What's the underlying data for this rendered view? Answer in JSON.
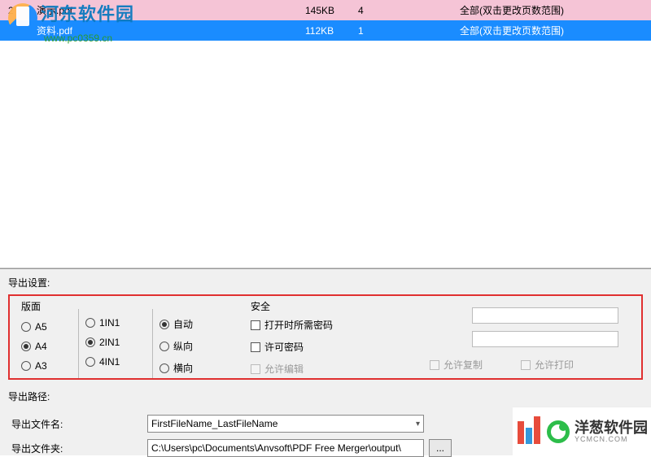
{
  "table": {
    "rows": [
      {
        "idx": "2",
        "name": "演示.pdf",
        "size": "145KB",
        "pages": "4",
        "range": "全部(双击更改页数范围)"
      },
      {
        "idx": "",
        "name": "资料.pdf",
        "size": "112KB",
        "pages": "1",
        "range": "全部(双击更改页数范围)"
      }
    ]
  },
  "watermark": {
    "name": "河东软件园",
    "url": "www.pc0359.cn"
  },
  "settings": {
    "title": "导出设置:",
    "layout_label": "版面",
    "paper": {
      "a5": "A5",
      "a4": "A4",
      "a3": "A3",
      "selected": "A4"
    },
    "nup": {
      "n1": "1IN1",
      "n2": "2IN1",
      "n4": "4IN1",
      "selected": "2IN1"
    },
    "orient": {
      "auto": "自动",
      "portrait": "纵向",
      "landscape": "横向",
      "selected": "自动"
    },
    "security_label": "安全",
    "open_pwd": "打开时所需密码",
    "perm_pwd": "许可密码",
    "allow_edit": "允许编辑",
    "allow_copy": "允许复制",
    "allow_print": "允许打印"
  },
  "export": {
    "path_label": "导出路径:",
    "filename_label": "导出文件名:",
    "folder_label": "导出文件夹:",
    "filename_value": "FirstFileName_LastFileName",
    "folder_value": "C:\\Users\\pc\\Documents\\Anvsoft\\PDF Free Merger\\output\\",
    "browse": "..."
  },
  "footer": {
    "name": "洋葱软件园",
    "url": "YCMCN.COM"
  }
}
